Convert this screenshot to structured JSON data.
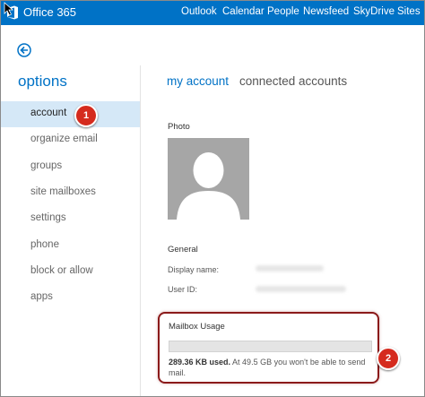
{
  "header": {
    "brand": "Office 365",
    "nav": [
      "Outlook",
      "Calendar",
      "People",
      "Newsfeed",
      "SkyDrive",
      "Sites"
    ]
  },
  "sidebar": {
    "title": "options",
    "items": [
      {
        "label": "account",
        "selected": true
      },
      {
        "label": "organize email"
      },
      {
        "label": "groups"
      },
      {
        "label": "site mailboxes"
      },
      {
        "label": "settings"
      },
      {
        "label": "phone"
      },
      {
        "label": "block or allow"
      },
      {
        "label": "apps"
      }
    ]
  },
  "tabs": {
    "active": "my account",
    "inactive": "connected accounts"
  },
  "account": {
    "photo_label": "Photo",
    "general_label": "General",
    "display_name_label": "Display name:",
    "user_id_label": "User ID:"
  },
  "mailbox": {
    "title": "Mailbox Usage",
    "used": "289.36 KB used.",
    "note": " At 49.5 GB you won't be able to send mail.",
    "usage_fraction": 0.0
  },
  "callouts": [
    "1",
    "2"
  ],
  "colors": {
    "accent": "#0072c6",
    "selected_bg": "#d5e8f7",
    "callout": "#d52b1e",
    "highlight_border": "#8b1a1a"
  },
  "icons": [
    "office-logo-icon",
    "cursor-icon",
    "back-arrow-icon",
    "person-placeholder-icon"
  ]
}
